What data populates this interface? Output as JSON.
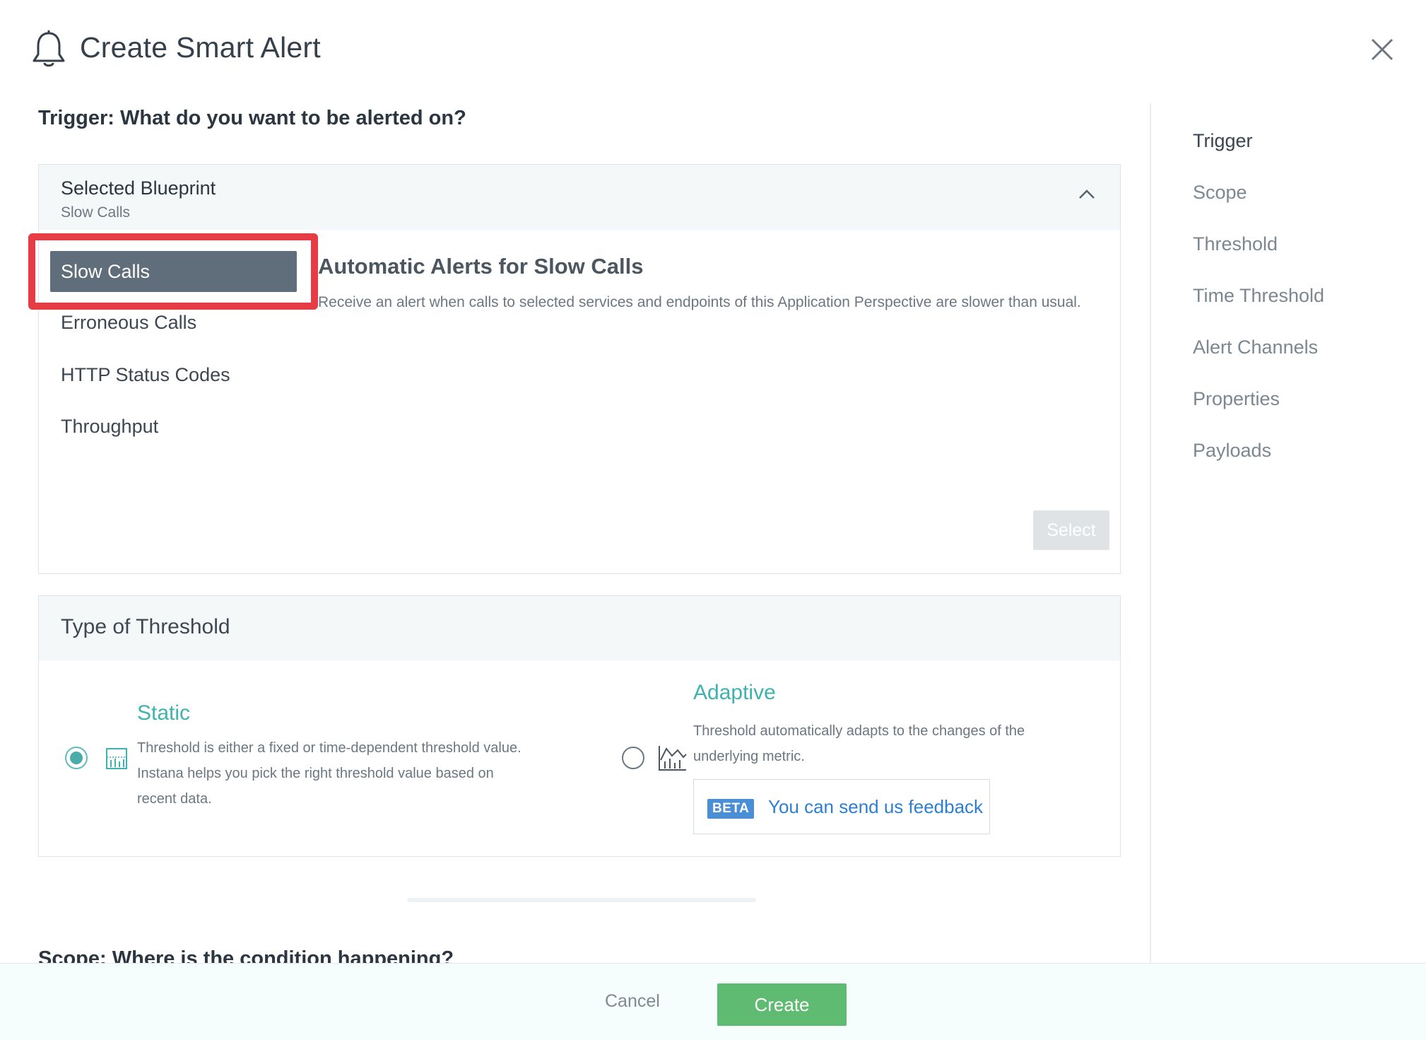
{
  "header": {
    "title": "Create Smart Alert"
  },
  "trigger": {
    "heading": "Trigger: What do you want to be alerted on?"
  },
  "blueprint": {
    "label": "Selected Blueprint",
    "selected": "Slow Calls",
    "items": [
      "Slow Calls",
      "Erroneous Calls",
      "HTTP Status Codes",
      "Throughput"
    ],
    "detail_title": "Automatic Alerts for Slow Calls",
    "detail_text": "Receive an alert when calls to selected services and endpoints of this Application Perspective are slower than usual.",
    "select_label": "Select"
  },
  "threshold_type": {
    "title": "Type of Threshold",
    "static": {
      "title": "Static",
      "text": "Threshold is either a fixed or time-dependent threshold value. Instana helps you pick the right threshold value based on recent data.",
      "selected": true
    },
    "adaptive": {
      "title": "Adaptive",
      "text": "Threshold automatically adapts to the changes of the underlying metric.",
      "selected": false,
      "beta_badge": "BETA",
      "feedback_link": "You can send us feedback"
    }
  },
  "scope": {
    "heading": "Scope: Where is the condition happening?"
  },
  "nav": {
    "items": [
      "Trigger",
      "Scope",
      "Threshold",
      "Time Threshold",
      "Alert Channels",
      "Properties",
      "Payloads"
    ]
  },
  "footer": {
    "cancel_label": "Cancel",
    "create_label": "Create"
  },
  "colors": {
    "accent": "#3fb2ae",
    "create": "#5fbb72",
    "highlight": "#e53c46",
    "link": "#2d7fd3"
  }
}
